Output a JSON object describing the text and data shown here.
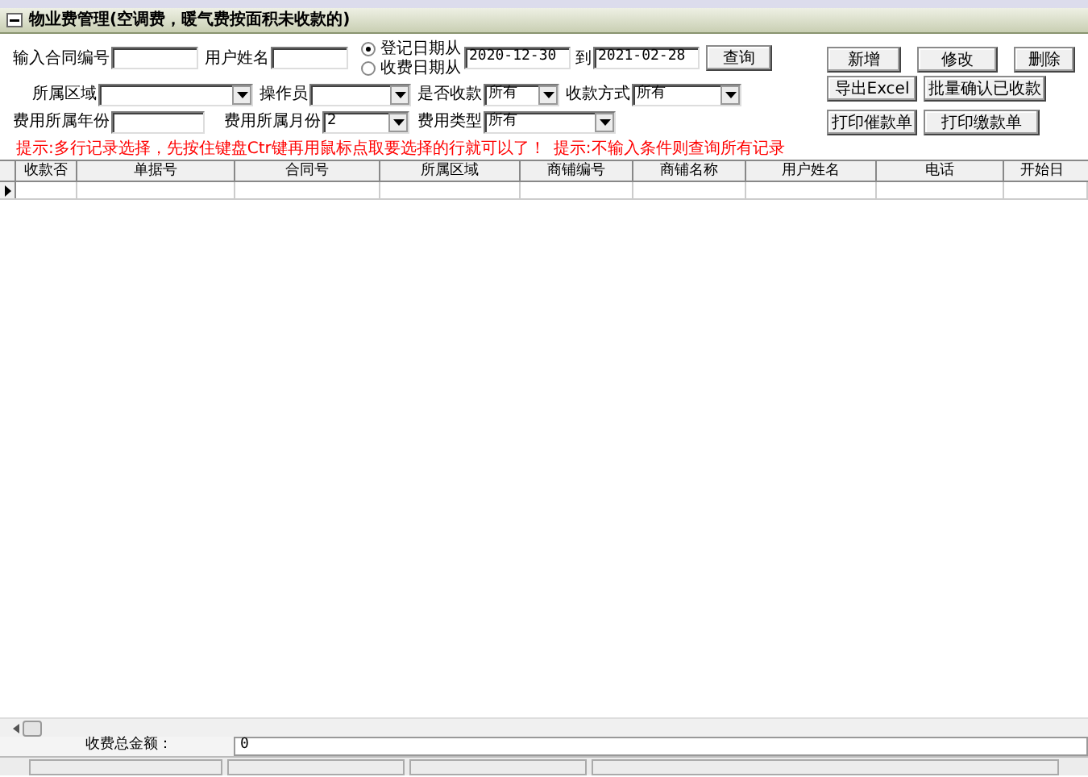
{
  "window": {
    "title": "物业费管理(空调费，暖气费按面积未收款的)"
  },
  "form_rows": [
    [
      {
        "kind": "text",
        "label": "输入合同编号"
      },
      {
        "kind": "text",
        "label": "用户姓名"
      },
      {
        "kind": "radio",
        "options": [
          {
            "label": "登记日期从",
            "selected": true
          },
          {
            "label": "收费日期从",
            "selected": false
          }
        ]
      },
      {
        "kind": "text",
        "value": "2020-12-30"
      },
      {
        "kind": "text",
        "label": "到",
        "value": "2021-02-28"
      },
      {
        "kind": "button",
        "label": "查询"
      }
    ],
    [
      {
        "kind": "select",
        "label": "所属区域"
      },
      {
        "kind": "select",
        "label": "操作员"
      },
      {
        "kind": "select",
        "label": "是否收款",
        "value": "所有"
      },
      {
        "kind": "select",
        "label": "收款方式",
        "value": "所有"
      }
    ],
    [
      {
        "kind": "text",
        "label": "费用所属年份"
      },
      {
        "kind": "select",
        "label": "费用所属月份",
        "value": "2"
      },
      {
        "kind": "select",
        "label": "费用类型",
        "value": "所有"
      }
    ]
  ],
  "hints": [
    "提示:多行记录选择，先按住键盘Ctr键再用鼠标点取要选择的行就可以了！",
    "提示:不输入条件则查询所有记录"
  ],
  "button_rows": [
    [
      "新增",
      "修改",
      "删除"
    ],
    [
      "导出Excel",
      "批量确认已收款"
    ],
    [
      "打印催款单",
      "打印缴款单"
    ]
  ],
  "table": {
    "columns": [
      "收款否",
      "单据号",
      "合同号",
      "所属区域",
      "商铺编号",
      "商铺名称",
      "用户姓名",
      "电话",
      "开始日"
    ],
    "rows": [
      {
        "current": true
      }
    ]
  },
  "footer": {
    "label": "收费总金额：",
    "value": "0"
  }
}
